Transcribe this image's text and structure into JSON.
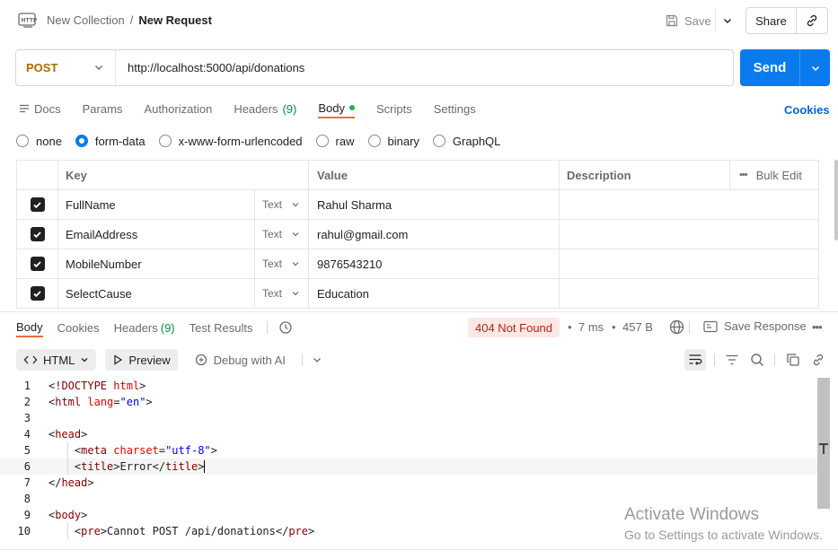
{
  "header": {
    "collection": "New Collection",
    "separator": "/",
    "request_name": "New Request",
    "save_label": "Save",
    "share_label": "Share"
  },
  "request": {
    "method": "POST",
    "url": "http://localhost:5000/api/donations",
    "send_label": "Send"
  },
  "request_tabs": {
    "docs": "Docs",
    "params": "Params",
    "authorization": "Authorization",
    "headers": "Headers",
    "headers_count": "(9)",
    "body": "Body",
    "scripts": "Scripts",
    "settings": "Settings",
    "cookies": "Cookies"
  },
  "body_types": [
    "none",
    "form-data",
    "x-www-form-urlencoded",
    "raw",
    "binary",
    "GraphQL"
  ],
  "body_type_selected": "form-data",
  "params_table": {
    "headers": {
      "key": "Key",
      "value": "Value",
      "description": "Description",
      "bulk_edit": "Bulk Edit"
    },
    "rows": [
      {
        "key": "FullName",
        "type": "Text",
        "value": "Rahul Sharma",
        "description": ""
      },
      {
        "key": "EmailAddress",
        "type": "Text",
        "value": "rahul@gmail.com",
        "description": ""
      },
      {
        "key": "MobileNumber",
        "type": "Text",
        "value": "9876543210",
        "description": ""
      },
      {
        "key": "SelectCause",
        "type": "Text",
        "value": "Education",
        "description": ""
      }
    ]
  },
  "response": {
    "tabs": {
      "body": "Body",
      "cookies": "Cookies",
      "headers": "Headers",
      "headers_count": "(9)",
      "test_results": "Test Results"
    },
    "status": "404 Not Found",
    "time": "7 ms",
    "size": "457 B",
    "save_response": "Save Response",
    "format": "HTML",
    "preview": "Preview",
    "debug_ai": "Debug with AI"
  },
  "code_lines": [
    {
      "n": "1",
      "text": "<!DOCTYPE html>"
    },
    {
      "n": "2",
      "text": "<html lang=\"en\">"
    },
    {
      "n": "3",
      "text": ""
    },
    {
      "n": "4",
      "text": "<head>"
    },
    {
      "n": "5",
      "text": "    <meta charset=\"utf-8\">"
    },
    {
      "n": "6",
      "text": "    <title>Error</title>"
    },
    {
      "n": "7",
      "text": "</head>"
    },
    {
      "n": "8",
      "text": ""
    },
    {
      "n": "9",
      "text": "<body>"
    },
    {
      "n": "10",
      "text": "    <pre>Cannot POST /api/donations</pre>"
    }
  ],
  "watermark": {
    "line1": "Activate Windows",
    "line2": "Go to Settings to activate Windows."
  },
  "colors": {
    "accent": "#097bed",
    "active_tab_underline": "#f26b3a",
    "status_error_bg": "#fde8e4",
    "status_error_fg": "#b42318",
    "method_post": "#a66e00"
  }
}
